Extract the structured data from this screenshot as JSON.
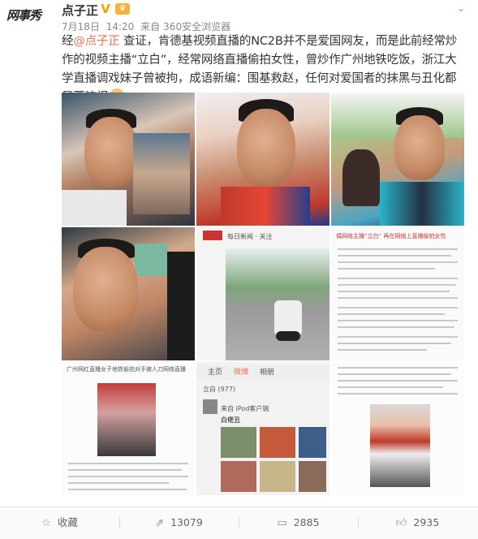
{
  "post": {
    "avatar_text": "网事秀",
    "username": "点子正",
    "verified_icon": "v-verified-icon",
    "level_icon": "member-crown-icon",
    "date": "7月18日",
    "time": "14:20",
    "source_prefix": "来自",
    "source": "360安全浏览器",
    "text_part1": "经",
    "mention": "@点子正",
    "text_part2": " 查证，肯德基视频直播的NC2B并不是爱国网友，而是此前经常炒作的视频主播“立白”，经常网络直播偷拍女性，曾炒作广州地铁吃饭，浙江大学直播调戏妹子曾被拘，成语新编：围基救赵，任何对爱国者的抹黑与丑化都是要流氓",
    "emoji": "dog-face-emoji"
  },
  "images": {
    "img5_header": "每日新闻 · 关注",
    "img6_title": "偶网络主播“立白”  再在网络上直播偷拍女性",
    "img7_title": "广州网红直播女子地铁偷拍对手被人刀网络直播",
    "img8_tabs": [
      "主页",
      "微博",
      "相册"
    ],
    "img8_title": "立白 (977)",
    "img8_sub": "来自 iPod客户端",
    "img8_name": "白佬丑"
  },
  "actions": {
    "favorite": "收藏",
    "repost": "13079",
    "comment": "2885",
    "like": "2935"
  },
  "colors": {
    "accent": "#eb7350",
    "badge": "#f6a100"
  }
}
